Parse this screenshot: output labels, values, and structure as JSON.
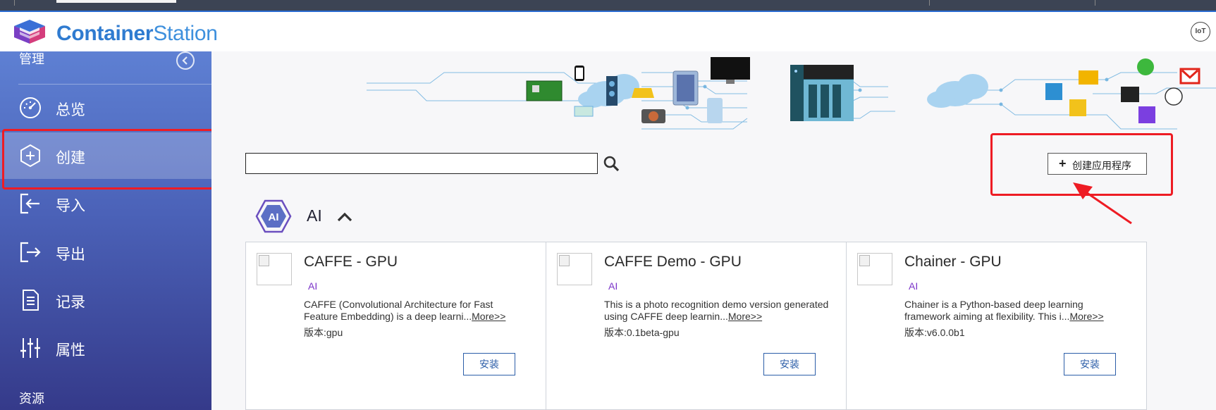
{
  "app": {
    "brand_bold": "Container",
    "brand_light": "Station",
    "iot_badge": "IoT",
    "accent_color": "#2f7bd0"
  },
  "sidebar": {
    "manage_header": "管理",
    "resources_header": "资源",
    "items": [
      {
        "label": "总览",
        "icon": "dashboard-icon"
      },
      {
        "label": "创建",
        "icon": "plus-hexagon-icon",
        "active": true
      },
      {
        "label": "导入",
        "icon": "import-icon"
      },
      {
        "label": "导出",
        "icon": "export-icon"
      },
      {
        "label": "记录",
        "icon": "document-icon"
      },
      {
        "label": "属性",
        "icon": "sliders-icon"
      }
    ]
  },
  "search": {
    "value": "",
    "icon": "search-icon"
  },
  "create_app_button": "创建应用程序",
  "category": {
    "label": "AI",
    "icon": "ai-hexagon-icon",
    "expanded": true
  },
  "apps": [
    {
      "title": "CAFFE - GPU",
      "tag": "AI",
      "desc": "CAFFE (Convolutional Architecture for Fast Feature Embedding) is a deep learni...",
      "more": "More>>",
      "version": "版本:gpu",
      "install": "安装"
    },
    {
      "title": "CAFFE Demo - GPU",
      "tag": "AI",
      "desc": "This is a photo recognition demo version generated using CAFFE deep learnin...",
      "more": "More>>",
      "version": "版本:0.1beta-gpu",
      "install": "安装"
    },
    {
      "title": "Chainer - GPU",
      "tag": "AI",
      "desc": "Chainer is a Python-based deep learning framework aiming at flexibility. This i...",
      "more": "More>>",
      "version": "版本:v6.0.0b1",
      "install": "安装"
    }
  ],
  "annotation_color": "#ee1c24"
}
